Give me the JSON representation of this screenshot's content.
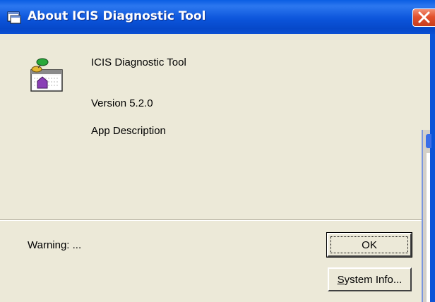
{
  "window": {
    "title": "About ICIS Diagnostic Tool",
    "icon": "app-window-icon",
    "close_icon": "close-x-icon"
  },
  "content": {
    "app_icon": "app-logo-icon",
    "product_name": "ICIS Diagnostic Tool",
    "version": "Version 5.2.0",
    "description": "App Description",
    "warning": "Warning: ..."
  },
  "buttons": {
    "ok_label": "OK",
    "system_info_prefix": "S",
    "system_info_rest": "ystem Info..."
  },
  "colors": {
    "titlebar": "#0b55db",
    "dialog_bg": "#ece9d8",
    "close_button": "#e2512e"
  }
}
